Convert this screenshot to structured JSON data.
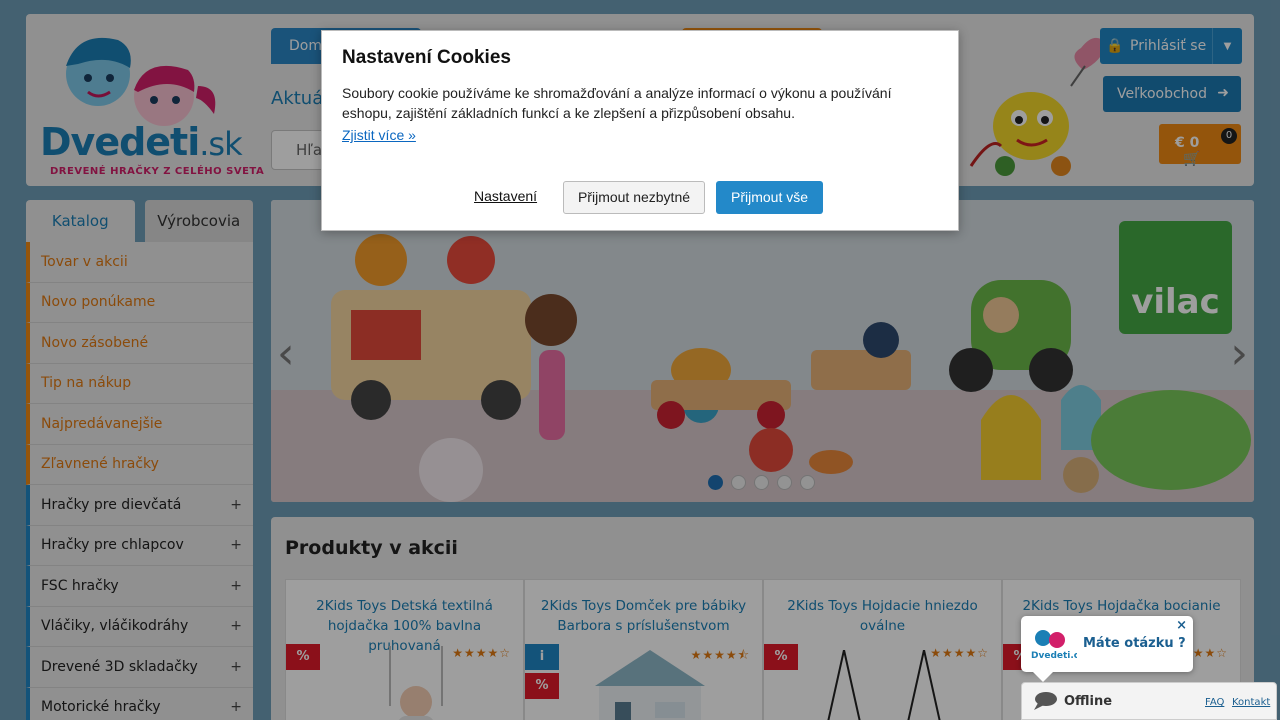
{
  "header": {
    "logo_text": "Dvedeti",
    "logo_tld": ".sk",
    "logo_tagline": "DREVENÉ HRAČKY Z CELÉHO SVETA",
    "nav_home": "Dom",
    "aktualne": "Aktuá",
    "search_placeholder": "Hľa",
    "login_label": "Prihlásiť se",
    "wholesale_label": "Veľkoobchod",
    "cart_amount": "€ 0",
    "cart_count": "0"
  },
  "sidebar": {
    "tabs": [
      "Katalog",
      "Výrobcovia"
    ],
    "items": [
      {
        "label": "Tovar v akcii"
      },
      {
        "label": "Novo ponúkame"
      },
      {
        "label": "Novo zásobené"
      },
      {
        "label": "Tip na nákup"
      },
      {
        "label": "Najpredávanejšie"
      },
      {
        "label": "Zľavnené hračky"
      },
      {
        "label": "Hračky pre dievčatá"
      },
      {
        "label": "Hračky pre chlapcov"
      },
      {
        "label": "FSC hračky"
      },
      {
        "label": "Vláčiky, vláčikodráhy"
      },
      {
        "label": "Drevené 3D skladačky"
      },
      {
        "label": "Motorické hračky"
      }
    ],
    "plus_symbol": "+"
  },
  "banner": {
    "brand": "vilac",
    "slides": 5,
    "active_slide": 1,
    "prev_icon": "chevron-left-icon",
    "next_icon": "chevron-right-icon"
  },
  "products": {
    "title": "Produkty v akcii",
    "badge_sale": "%",
    "badge_info": "i",
    "items": [
      {
        "name": "2Kids Toys Detská textilná hojdačka 100% bavlna pruhovaná",
        "rating": "★★★★☆"
      },
      {
        "name": "2Kids Toys Domček pre bábiky Barbora s príslušenstvom",
        "rating": "★★★★⯪"
      },
      {
        "name": "2Kids Toys Hojdacie hniezdo oválne",
        "rating": "★★★★☆"
      },
      {
        "name": "2Kids Toys Hojdačka bocianie",
        "rating": "★★★★☆"
      }
    ]
  },
  "cookie": {
    "title": "Nastavení Cookies",
    "text": "Soubory cookie používáme ke shromažďování a analýze informací o výkonu a používání eshopu, zajištění základních funkcí a ke zlepšení a přizpůsobení obsahu.",
    "more_link": "Zjistit více »",
    "settings_button": "Nastavení",
    "necessary_button": "Přijmout nezbytné",
    "accept_all_button": "Přijmout vše"
  },
  "chat": {
    "question": "Máte otázku ?",
    "close": "×",
    "status": "Offline",
    "faq": "FAQ",
    "contact": "Kontakt",
    "mini_logo": "Dvedeti.cz"
  },
  "colors": {
    "accent_blue": "#1f87c5",
    "accent_orange": "#ef8a14",
    "sale_red": "#e01b2a"
  }
}
